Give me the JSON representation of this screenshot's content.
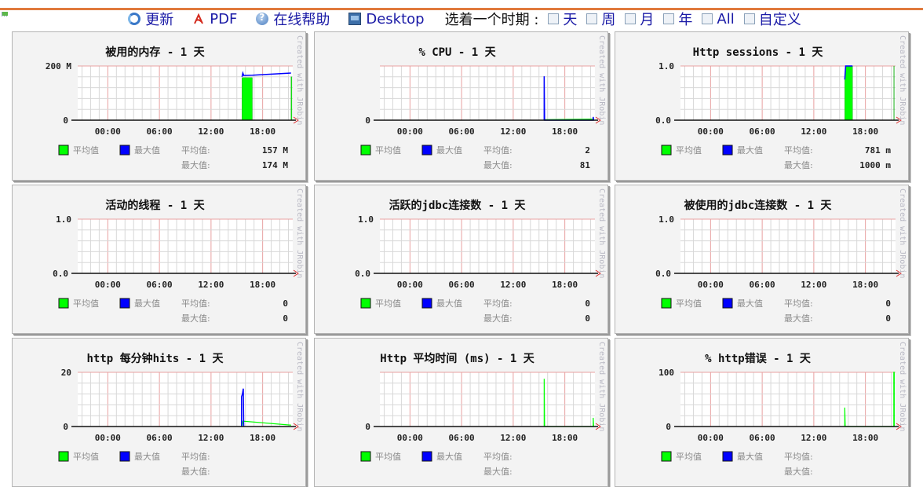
{
  "toolbar": {
    "refresh": {
      "label": "更新",
      "icon": "refresh-icon"
    },
    "pdf": {
      "label": "PDF",
      "icon": "pdf-icon"
    },
    "help": {
      "label": "在线帮助",
      "icon": "help-icon"
    },
    "desktop": {
      "label": "Desktop",
      "icon": "desktop-icon"
    },
    "period_prompt": "选着一个时期 :",
    "periods": [
      {
        "label": "天",
        "icon": "calendar-day-icon"
      },
      {
        "label": "周",
        "icon": "calendar-week-icon"
      },
      {
        "label": "月",
        "icon": "calendar-month-icon"
      },
      {
        "label": "年",
        "icon": "calendar-year-icon"
      },
      {
        "label": "All",
        "icon": "calendar-all-icon"
      },
      {
        "label": "自定义",
        "icon": "calendar-custom-icon"
      }
    ]
  },
  "legend": {
    "avg_label": "平均值",
    "max_label": "最大值",
    "avg_stat_label": "平均值:",
    "max_stat_label": "最大值:",
    "avg_color": "#00ff00",
    "max_color": "#0000ff"
  },
  "watermark": "Created with JRobin",
  "chart_data": [
    {
      "type": "area",
      "title": "被用的内存 - 1 天",
      "y_ticks": [
        "200 M",
        "0"
      ],
      "ylim": [
        0,
        200
      ],
      "x_ticks": [
        "00:00",
        "06:00",
        "12:00",
        "18:00"
      ],
      "xlim_hours": [
        -3.5,
        21.5
      ],
      "series": [
        {
          "name": "平均值",
          "points": [
            [
              15.6,
              0
            ],
            [
              15.6,
              157
            ],
            [
              16.8,
              157
            ],
            [
              16.8,
              0
            ],
            [
              21.3,
              0
            ],
            [
              21.3,
              160
            ],
            [
              21.4,
              160
            ],
            [
              21.4,
              0
            ]
          ]
        },
        {
          "name": "最大值",
          "points": [
            [
              15.6,
              160
            ],
            [
              15.7,
              174
            ],
            [
              15.8,
              165
            ],
            [
              16.8,
              166
            ],
            [
              21.3,
              174
            ]
          ]
        }
      ],
      "avg_value": "157 M",
      "max_value": "174 M"
    },
    {
      "type": "line",
      "title": "% CPU - 1 天",
      "y_ticks": [
        "",
        "0"
      ],
      "ylim": [
        0,
        100
      ],
      "x_ticks": [
        "00:00",
        "06:00",
        "12:00",
        "18:00"
      ],
      "xlim_hours": [
        -3.5,
        21.5
      ],
      "series": [
        {
          "name": "平均值",
          "points": [
            [
              15.6,
              1
            ],
            [
              21.3,
              2
            ]
          ]
        },
        {
          "name": "最大值",
          "points": [
            [
              15.6,
              0
            ],
            [
              15.6,
              81
            ],
            [
              15.65,
              0
            ],
            [
              21.3,
              0
            ],
            [
              21.3,
              6
            ],
            [
              21.35,
              0
            ]
          ]
        }
      ],
      "avg_value": "2",
      "max_value": "81"
    },
    {
      "type": "area",
      "title": "Http sessions - 1 天",
      "y_ticks": [
        "1.0",
        "0.0"
      ],
      "ylim": [
        0,
        1
      ],
      "x_ticks": [
        "00:00",
        "06:00",
        "12:00",
        "18:00"
      ],
      "xlim_hours": [
        -3.5,
        21.5
      ],
      "series": [
        {
          "name": "平均值",
          "points": [
            [
              15.6,
              0
            ],
            [
              15.6,
              0.78
            ],
            [
              15.7,
              1
            ],
            [
              16.5,
              1
            ],
            [
              16.5,
              0
            ],
            [
              21.3,
              0
            ],
            [
              21.3,
              1
            ],
            [
              21.35,
              1
            ],
            [
              21.35,
              0
            ]
          ]
        },
        {
          "name": "最大值",
          "points": [
            [
              15.6,
              0.75
            ],
            [
              15.7,
              1
            ],
            [
              16.5,
              1
            ]
          ]
        }
      ],
      "avg_value": "781 m",
      "max_value": "1000 m"
    },
    {
      "type": "line",
      "title": "活动的线程 - 1 天",
      "y_ticks": [
        "1.0",
        "0.0"
      ],
      "ylim": [
        0,
        1
      ],
      "x_ticks": [
        "00:00",
        "06:00",
        "12:00",
        "18:00"
      ],
      "xlim_hours": [
        -3.5,
        21.5
      ],
      "series": [
        {
          "name": "平均值",
          "points": []
        },
        {
          "name": "最大值",
          "points": []
        }
      ],
      "avg_value": "0",
      "max_value": "0"
    },
    {
      "type": "line",
      "title": "活跃的jdbc连接数 - 1 天",
      "y_ticks": [
        "1.0",
        "0.0"
      ],
      "ylim": [
        0,
        1
      ],
      "x_ticks": [
        "00:00",
        "06:00",
        "12:00",
        "18:00"
      ],
      "xlim_hours": [
        -3.5,
        21.5
      ],
      "series": [
        {
          "name": "平均值",
          "points": []
        },
        {
          "name": "最大值",
          "points": []
        }
      ],
      "avg_value": "0",
      "max_value": "0"
    },
    {
      "type": "line",
      "title": "被使用的jdbc连接数 - 1 天",
      "y_ticks": [
        "1.0",
        "0.0"
      ],
      "ylim": [
        0,
        1
      ],
      "x_ticks": [
        "00:00",
        "06:00",
        "12:00",
        "18:00"
      ],
      "xlim_hours": [
        -3.5,
        21.5
      ],
      "series": [
        {
          "name": "平均值",
          "points": []
        },
        {
          "name": "最大值",
          "points": []
        }
      ],
      "avg_value": "0",
      "max_value": "0"
    },
    {
      "type": "line",
      "title": "http 每分钟hits - 1 天",
      "y_ticks": [
        "20",
        "0"
      ],
      "ylim": [
        0,
        20
      ],
      "x_ticks": [
        "00:00",
        "06:00",
        "12:00",
        "18:00"
      ],
      "xlim_hours": [
        -3.5,
        21.5
      ],
      "series": [
        {
          "name": "平均值",
          "points": [
            [
              15.6,
              0
            ],
            [
              15.7,
              2
            ],
            [
              21.3,
              0.5
            ]
          ]
        },
        {
          "name": "最大值",
          "points": [
            [
              15.55,
              0
            ],
            [
              15.55,
              11
            ],
            [
              15.65,
              12
            ],
            [
              15.75,
              14
            ],
            [
              15.8,
              0
            ]
          ]
        }
      ],
      "avg_value": "",
      "max_value": ""
    },
    {
      "type": "line",
      "title": "Http 平均时间 (ms) - 1 天",
      "y_ticks": [
        "",
        "0"
      ],
      "ylim": [
        0,
        100
      ],
      "x_ticks": [
        "00:00",
        "06:00",
        "12:00",
        "18:00"
      ],
      "xlim_hours": [
        -3.5,
        21.5
      ],
      "series": [
        {
          "name": "平均值",
          "points": [
            [
              15.6,
              0
            ],
            [
              15.6,
              88
            ],
            [
              15.65,
              0
            ],
            [
              21.3,
              0
            ],
            [
              21.3,
              16
            ],
            [
              21.35,
              0
            ]
          ]
        },
        {
          "name": "最大值",
          "points": []
        }
      ],
      "avg_value": "",
      "max_value": ""
    },
    {
      "type": "line",
      "title": "% http错误 - 1 天",
      "y_ticks": [
        "100",
        "0"
      ],
      "ylim": [
        0,
        100
      ],
      "x_ticks": [
        "00:00",
        "06:00",
        "12:00",
        "18:00"
      ],
      "xlim_hours": [
        -3.5,
        21.5
      ],
      "series": [
        {
          "name": "平均值",
          "points": [
            [
              15.6,
              0
            ],
            [
              15.6,
              35
            ],
            [
              15.65,
              0
            ],
            [
              21.3,
              0
            ],
            [
              21.3,
              100
            ],
            [
              21.35,
              100
            ],
            [
              21.35,
              0
            ]
          ]
        },
        {
          "name": "最大值",
          "points": []
        }
      ],
      "avg_value": "",
      "max_value": ""
    }
  ]
}
